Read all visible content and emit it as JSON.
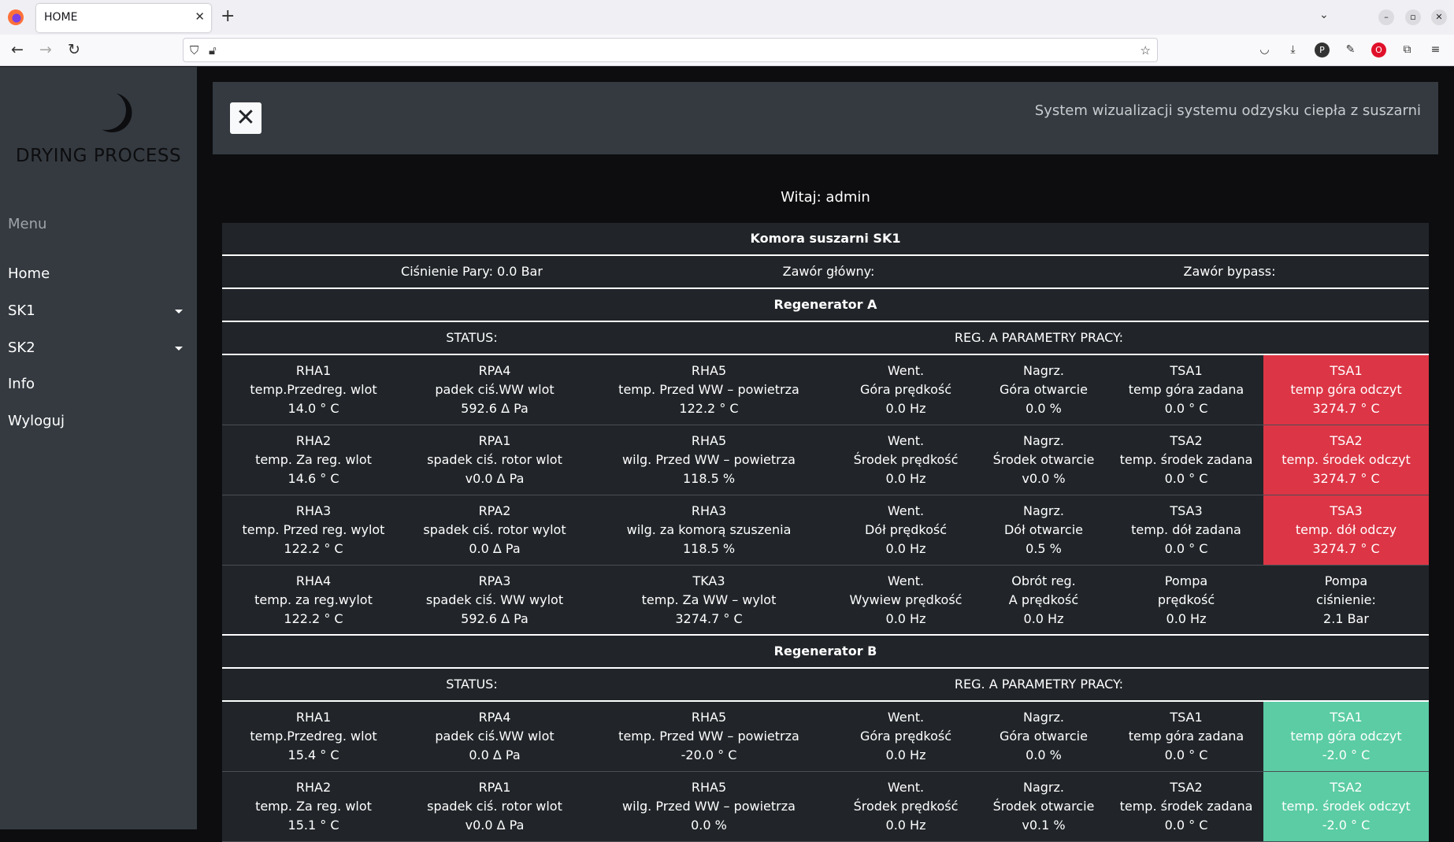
{
  "browser": {
    "tab_title": "HOME",
    "tab_close": "✕",
    "new_tab": "+",
    "tab_list": "⌄",
    "win_min": "–",
    "win_max": "▫",
    "win_close": "✕"
  },
  "sidebar": {
    "logo_text": "DRYING PROCESS",
    "menu_label": "Menu",
    "items": [
      {
        "label": "Home",
        "dropdown": false
      },
      {
        "label": "SK1",
        "dropdown": true
      },
      {
        "label": "SK2",
        "dropdown": true
      },
      {
        "label": "Info",
        "dropdown": false
      },
      {
        "label": "Wyloguj",
        "dropdown": false
      }
    ]
  },
  "header": {
    "close_symbol": "✕",
    "system_title": "System wizualizacji systemu odzysku ciepła z suszarni"
  },
  "welcome": "Witaj: admin",
  "chamber": {
    "title": "Komora suszarni SK1",
    "steam_pressure": "Ciśnienie Pary: 0.0 Bar",
    "main_valve": "Zawór główny:",
    "bypass_valve": "Zawór bypass:"
  },
  "regenerators": [
    {
      "title": "Regenerator A",
      "status_label": "STATUS:",
      "params_label": "REG. A PARAMETRY PRACY:",
      "rows": [
        [
          {
            "l1": "RHA1",
            "l2": "temp.Przedreg. wlot",
            "l3": "14.0 ° C"
          },
          {
            "l1": "RPA4",
            "l2": "padek ciś.WW wlot",
            "l3": "592.6 Δ Pa"
          },
          {
            "l1": "RHA5",
            "l2": "temp. Przed WW – powietrza",
            "l3": "122.2 ° C"
          },
          {
            "l1": "Went.",
            "l2": "Góra prędkość",
            "l3": "0.0 Hz"
          },
          {
            "l1": "Nagrz.",
            "l2": "Góra otwarcie",
            "l3": "0.0 %"
          },
          {
            "l1": "TSA1",
            "l2": "temp góra zadana",
            "l3": "0.0 ° C"
          },
          {
            "l1": "TSA1",
            "l2": "temp góra odczyt",
            "l3": "3274.7 ° C",
            "state": "red"
          }
        ],
        [
          {
            "l1": "RHA2",
            "l2": "temp. Za reg. wlot",
            "l3": "14.6 ° C"
          },
          {
            "l1": "RPA1",
            "l2": "spadek ciś. rotor wlot",
            "l3": "v0.0 Δ Pa"
          },
          {
            "l1": "RHA5",
            "l2": "wilg. Przed WW – powietrza",
            "l3": "118.5 %"
          },
          {
            "l1": "Went.",
            "l2": "Środek prędkość",
            "l3": "0.0 Hz"
          },
          {
            "l1": "Nagrz.",
            "l2": "Środek otwarcie",
            "l3": "v0.0 %"
          },
          {
            "l1": "TSA2",
            "l2": "temp. środek zadana",
            "l3": "0.0 ° C"
          },
          {
            "l1": "TSA2",
            "l2": "temp. środek odczyt",
            "l3": "3274.7 ° C",
            "state": "red"
          }
        ],
        [
          {
            "l1": "RHA3",
            "l2": "temp. Przed reg. wylot",
            "l3": "122.2 ° C"
          },
          {
            "l1": "RPA2",
            "l2": "spadek ciś. rotor wylot",
            "l3": "0.0 Δ Pa"
          },
          {
            "l1": "RHA3",
            "l2": "wilg. za komorą szuszenia",
            "l3": "118.5 %"
          },
          {
            "l1": "Went.",
            "l2": "Dół prędkość",
            "l3": "0.0 Hz"
          },
          {
            "l1": "Nagrz.",
            "l2": "Dół otwarcie",
            "l3": "0.5 %"
          },
          {
            "l1": "TSA3",
            "l2": "temp. dół zadana",
            "l3": "0.0 ° C"
          },
          {
            "l1": "TSA3",
            "l2": "temp. dół odczy",
            "l3": "3274.7 ° C",
            "state": "red"
          }
        ],
        [
          {
            "l1": "RHA4",
            "l2": "temp. za reg.wylot",
            "l3": "122.2 ° C"
          },
          {
            "l1": "RPA3",
            "l2": "spadek ciś. WW wylot",
            "l3": "592.6 Δ Pa"
          },
          {
            "l1": "TKA3",
            "l2": "temp. Za WW – wylot",
            "l3": "3274.7 ° C"
          },
          {
            "l1": "Went.",
            "l2": "Wywiew prędkość",
            "l3": "0.0 Hz"
          },
          {
            "l1": "Obrót reg.",
            "l2": "A prędkość",
            "l3": "0.0 Hz"
          },
          {
            "l1": "Pompa",
            "l2": "prędkość",
            "l3": "0.0 Hz"
          },
          {
            "l1": "Pompa",
            "l2": "ciśnienie:",
            "l3": "2.1 Bar"
          }
        ]
      ]
    },
    {
      "title": "Regenerator B",
      "status_label": "STATUS:",
      "params_label": "REG. A PARAMETRY PRACY:",
      "rows": [
        [
          {
            "l1": "RHA1",
            "l2": "temp.Przedreg. wlot",
            "l3": "15.4 ° C"
          },
          {
            "l1": "RPA4",
            "l2": "padek ciś.WW wlot",
            "l3": "0.0 Δ Pa"
          },
          {
            "l1": "RHA5",
            "l2": "temp. Przed WW – powietrza",
            "l3": "-20.0 ° C"
          },
          {
            "l1": "Went.",
            "l2": "Góra prędkość",
            "l3": "0.0 Hz"
          },
          {
            "l1": "Nagrz.",
            "l2": "Góra otwarcie",
            "l3": "0.0 %"
          },
          {
            "l1": "TSA1",
            "l2": "temp góra zadana",
            "l3": "0.0 ° C"
          },
          {
            "l1": "TSA1",
            "l2": "temp góra odczyt",
            "l3": "-2.0 ° C",
            "state": "green"
          }
        ],
        [
          {
            "l1": "RHA2",
            "l2": "temp. Za reg. wlot",
            "l3": "15.1 ° C"
          },
          {
            "l1": "RPA1",
            "l2": "spadek ciś. rotor wlot",
            "l3": "v0.0 Δ Pa"
          },
          {
            "l1": "RHA5",
            "l2": "wilg. Przed WW – powietrza",
            "l3": "0.0 %"
          },
          {
            "l1": "Went.",
            "l2": "Środek prędkość",
            "l3": "0.0 Hz"
          },
          {
            "l1": "Nagrz.",
            "l2": "Środek otwarcie",
            "l3": "v0.1 %"
          },
          {
            "l1": "TSA2",
            "l2": "temp. środek zadana",
            "l3": "0.0 ° C"
          },
          {
            "l1": "TSA2",
            "l2": "temp. środek odczyt",
            "l3": "-2.0 ° C",
            "state": "green"
          }
        ]
      ]
    }
  ],
  "colors": {
    "alarm_red": "#dc3545",
    "ok_green": "#5bcca4",
    "sidebar_bg": "#343a40",
    "table_bg": "#212529"
  }
}
